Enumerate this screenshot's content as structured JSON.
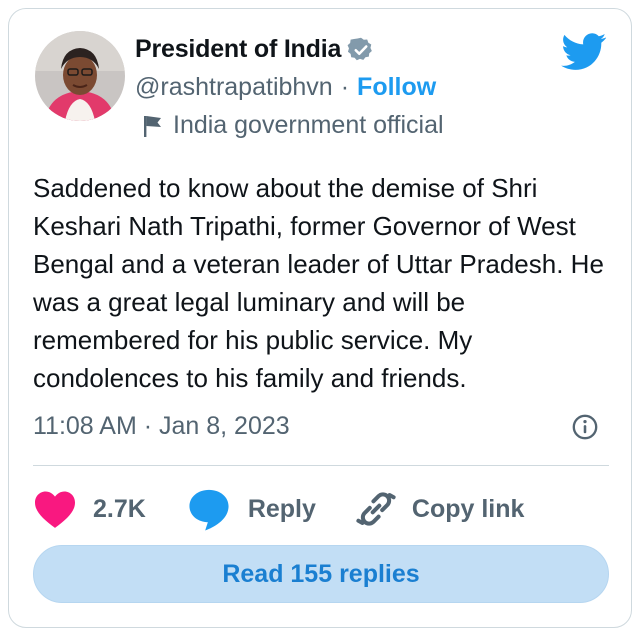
{
  "author": {
    "display_name": "President of India",
    "handle": "@rashtrapatibhvn",
    "follow_label": "Follow",
    "label_text": "India government official",
    "separator": "·"
  },
  "icons": {
    "verified": "verified-badge-icon",
    "flag": "flag-icon",
    "brand": "twitter-bird-icon",
    "info": "info-icon",
    "like": "heart-icon",
    "reply": "speech-bubble-icon",
    "copy": "link-icon"
  },
  "tweet": {
    "text": "Saddened to know about the demise of Shri Keshari Nath Tripathi, former Governor of West Bengal and a veteran leader of Uttar Pradesh. He was a great legal luminary and will be remembered for his public service. My condolences to his family and friends.",
    "timestamp": "11:08 AM · Jan 8, 2023"
  },
  "actions": {
    "like_count": "2.7K",
    "reply_label": "Reply",
    "copy_label": "Copy link"
  },
  "read_replies_label": "Read 155 replies",
  "colors": {
    "accent": "#1d9bf0",
    "like": "#f91880",
    "muted": "#536471",
    "button_bg": "#c2def5"
  }
}
